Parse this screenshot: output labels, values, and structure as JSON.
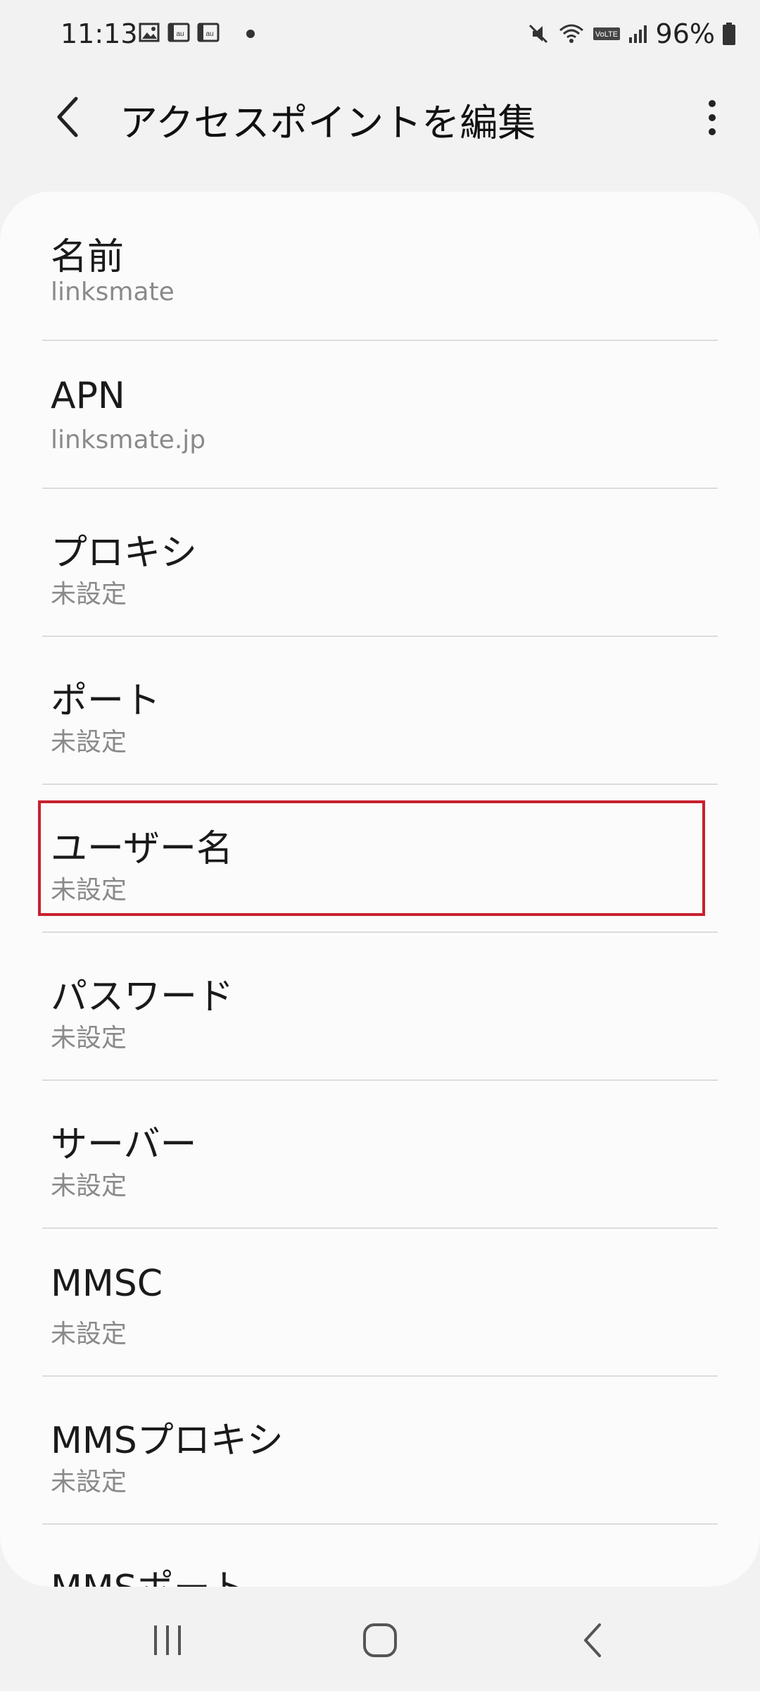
{
  "status_bar": {
    "time": "11:13",
    "battery": "96%",
    "notification_icons": [
      "image-icon",
      "au-icon",
      "au-icon"
    ],
    "system_icons": [
      "mute-icon",
      "wifi-icon",
      "volte-icon",
      "signal-icon",
      "battery-icon"
    ]
  },
  "app_bar": {
    "title": "アクセスポイントを編集"
  },
  "settings": [
    {
      "label": "名前",
      "value": "linksmate"
    },
    {
      "label": "APN",
      "value": "linksmate.jp"
    },
    {
      "label": "プロキシ",
      "value": "未設定"
    },
    {
      "label": "ポート",
      "value": "未設定"
    },
    {
      "label": "ユーザー名",
      "value": "未設定"
    },
    {
      "label": "パスワード",
      "value": "未設定"
    },
    {
      "label": "サーバー",
      "value": "未設定"
    },
    {
      "label": "MMSC",
      "value": "未設定"
    },
    {
      "label": "MMSプロキシ",
      "value": "未設定"
    },
    {
      "label": "MMSポート",
      "value": ""
    }
  ],
  "highlight_color": "#c8202e",
  "nav_bar": {
    "buttons": [
      "recent-apps-icon",
      "home-icon",
      "back-icon"
    ]
  }
}
